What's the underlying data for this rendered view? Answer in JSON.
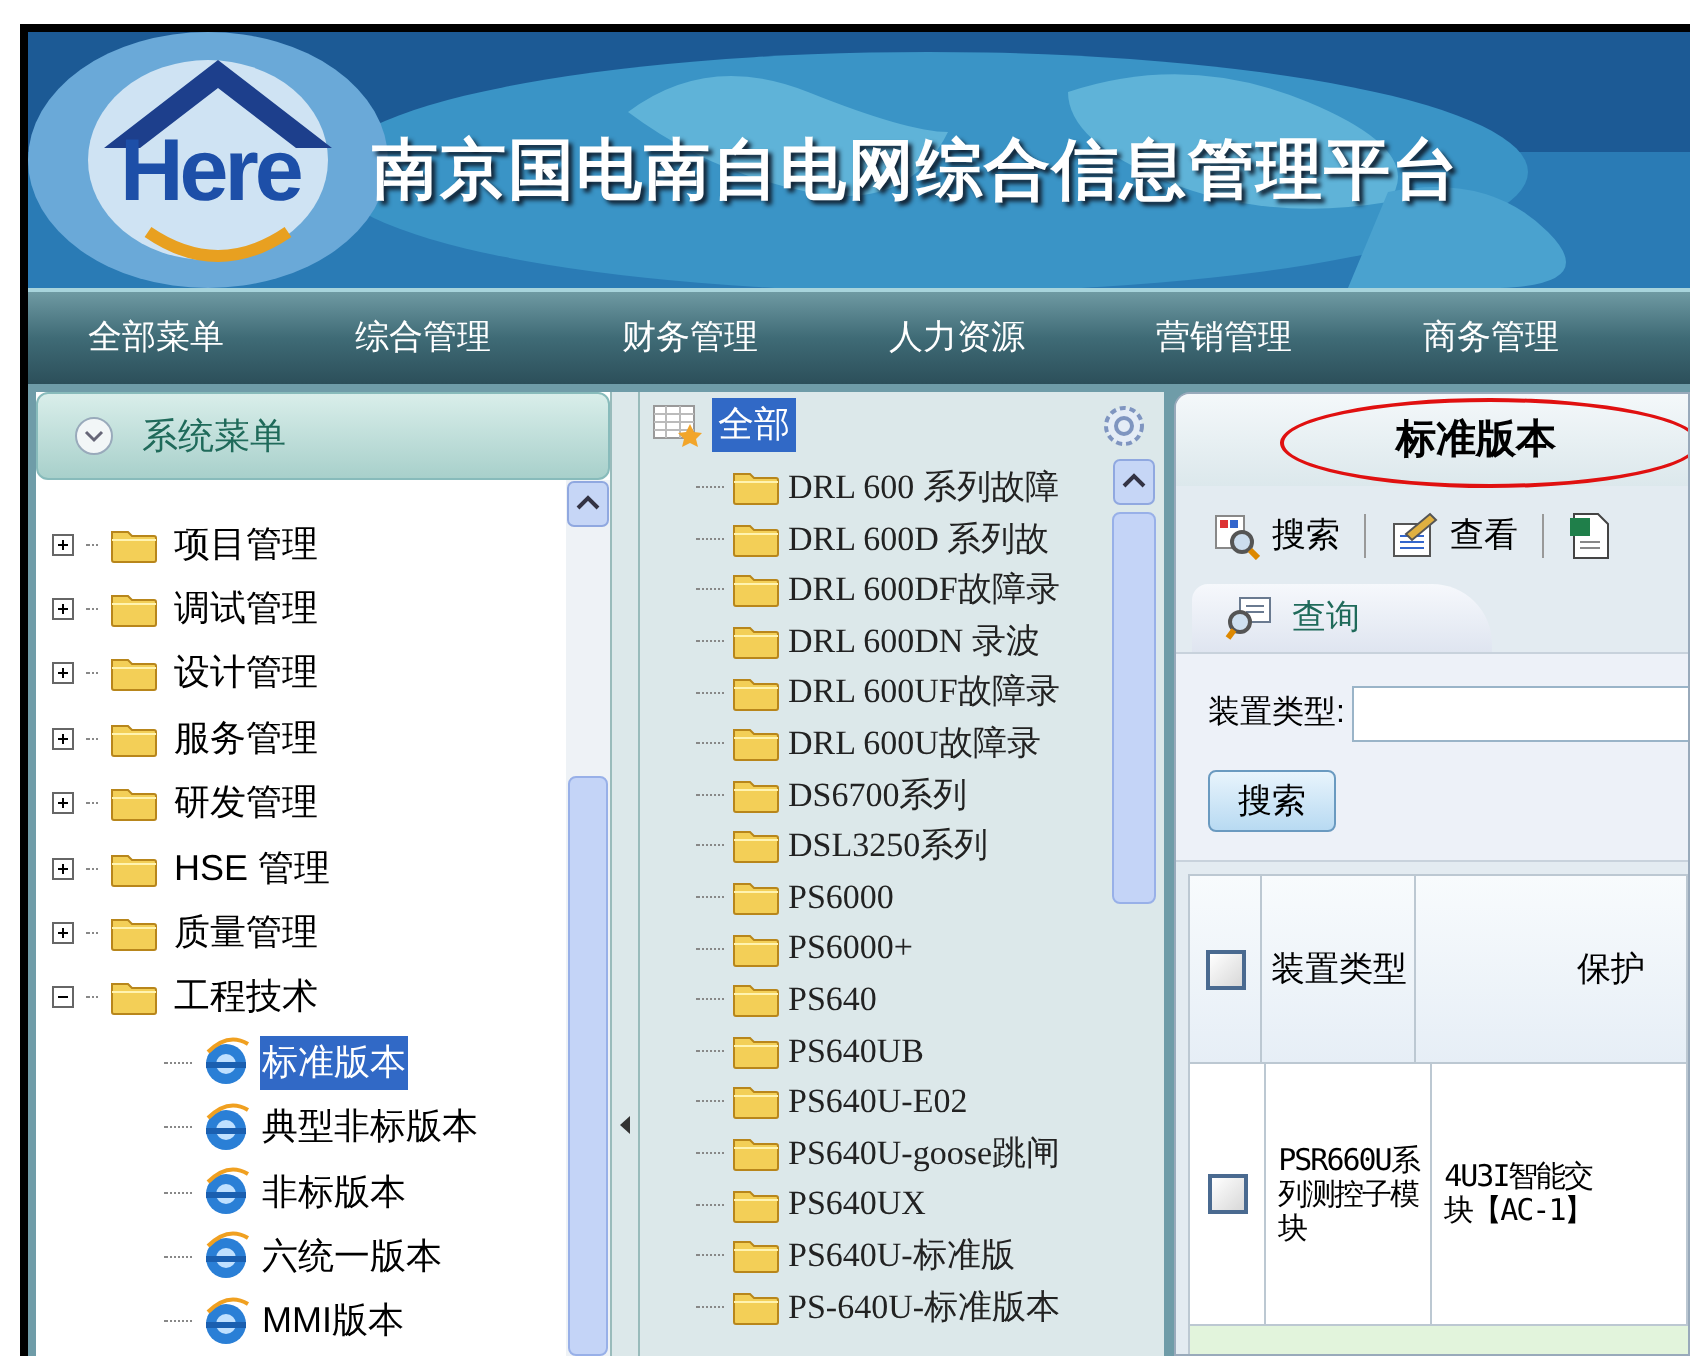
{
  "header": {
    "logo": "Here",
    "title": "南京国电南自电网综合信息管理平台"
  },
  "nav": [
    {
      "label": "全部菜单"
    },
    {
      "label": "综合管理"
    },
    {
      "label": "财务管理"
    },
    {
      "label": "人力资源"
    },
    {
      "label": "营销管理"
    },
    {
      "label": "商务管理"
    }
  ],
  "sidebar": {
    "title": "系统菜单",
    "tree": [
      {
        "label": "项目管理",
        "expanded": false
      },
      {
        "label": "调试管理",
        "expanded": false
      },
      {
        "label": "设计管理",
        "expanded": false
      },
      {
        "label": "服务管理",
        "expanded": false
      },
      {
        "label": "研发管理",
        "expanded": false
      },
      {
        "label": "HSE 管理",
        "expanded": false
      },
      {
        "label": "质量管理",
        "expanded": false
      },
      {
        "label": "工程技术",
        "expanded": true,
        "children": [
          {
            "label": "标准版本",
            "selected": true
          },
          {
            "label": "典型非标版本",
            "selected": false
          },
          {
            "label": "非标版本",
            "selected": false
          },
          {
            "label": "六统一版本",
            "selected": false
          },
          {
            "label": "MMI版本",
            "selected": false
          }
        ]
      }
    ]
  },
  "category_panel": {
    "root": {
      "label": "全部",
      "selected": true
    },
    "items": [
      "DRL 600 系列故障",
      "DRL 600D 系列故",
      "DRL 600DF故障录",
      "DRL 600DN 录波",
      "DRL 600UF故障录",
      "DRL 600U故障录",
      "DS6700系列",
      "DSL3250系列",
      "PS6000",
      "PS6000+",
      "PS640",
      "PS640UB",
      "PS640U-E02",
      "PS640U-goose跳闸",
      "PS640UX",
      "PS640U-标准版",
      "PS-640U-标准版本"
    ]
  },
  "content": {
    "title": "标准版本",
    "toolbar": [
      {
        "kind": "search",
        "label": "搜索"
      },
      {
        "kind": "view",
        "label": "查看"
      },
      {
        "kind": "export"
      }
    ],
    "query_tab": "查询",
    "form": {
      "label": "装置类型:",
      "button": "搜索"
    },
    "table": {
      "select_all_checked": false,
      "columns": [
        "装置类型",
        "保护"
      ],
      "rows": [
        {
          "checked": false,
          "cells": [
            "PSR660U系列测控子模块",
            "4U3I智能交块【AC-1】"
          ]
        }
      ]
    }
  }
}
